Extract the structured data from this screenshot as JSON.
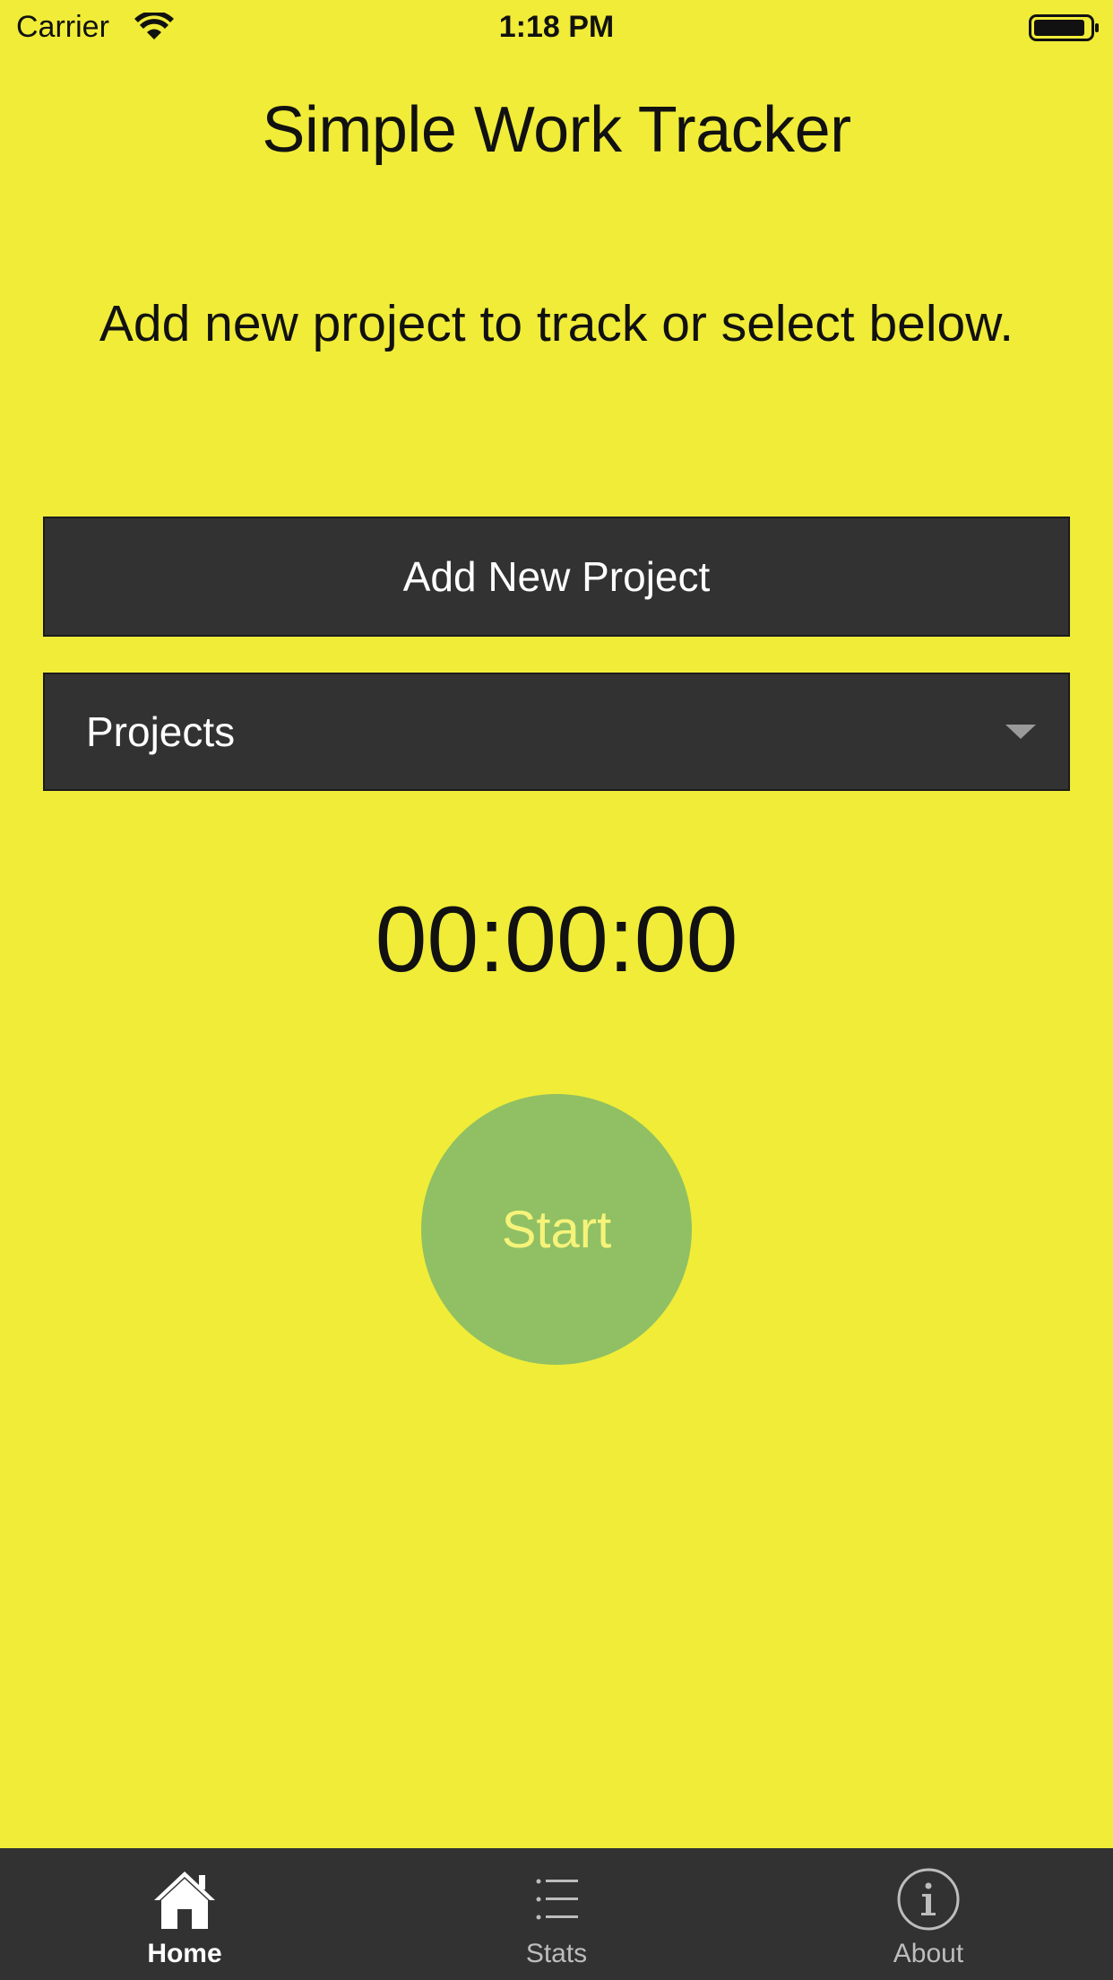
{
  "status_bar": {
    "carrier": "Carrier",
    "time": "1:18 PM",
    "wifi_icon": "wifi-icon",
    "battery_icon": "battery-icon"
  },
  "header": {
    "title": "Simple Work Tracker"
  },
  "instruction": "Add new project to track or select below.",
  "add_project_button": {
    "label": "Add New Project"
  },
  "projects_dropdown": {
    "selected": "Projects",
    "icon": "chevron-down-icon"
  },
  "timer": {
    "value": "00:00:00"
  },
  "start_button": {
    "label": "Start"
  },
  "tab_bar": {
    "tabs": [
      {
        "label": "Home",
        "icon": "home-icon",
        "active": true
      },
      {
        "label": "Stats",
        "icon": "list-icon",
        "active": false
      },
      {
        "label": "About",
        "icon": "info-icon",
        "active": false
      }
    ]
  },
  "colors": {
    "background": "#f0ec38",
    "dark_surface": "#323232",
    "start_button": "#90c063",
    "start_text": "#f6f37a",
    "tab_active": "#ffffff",
    "tab_inactive": "#bdbdbd"
  }
}
